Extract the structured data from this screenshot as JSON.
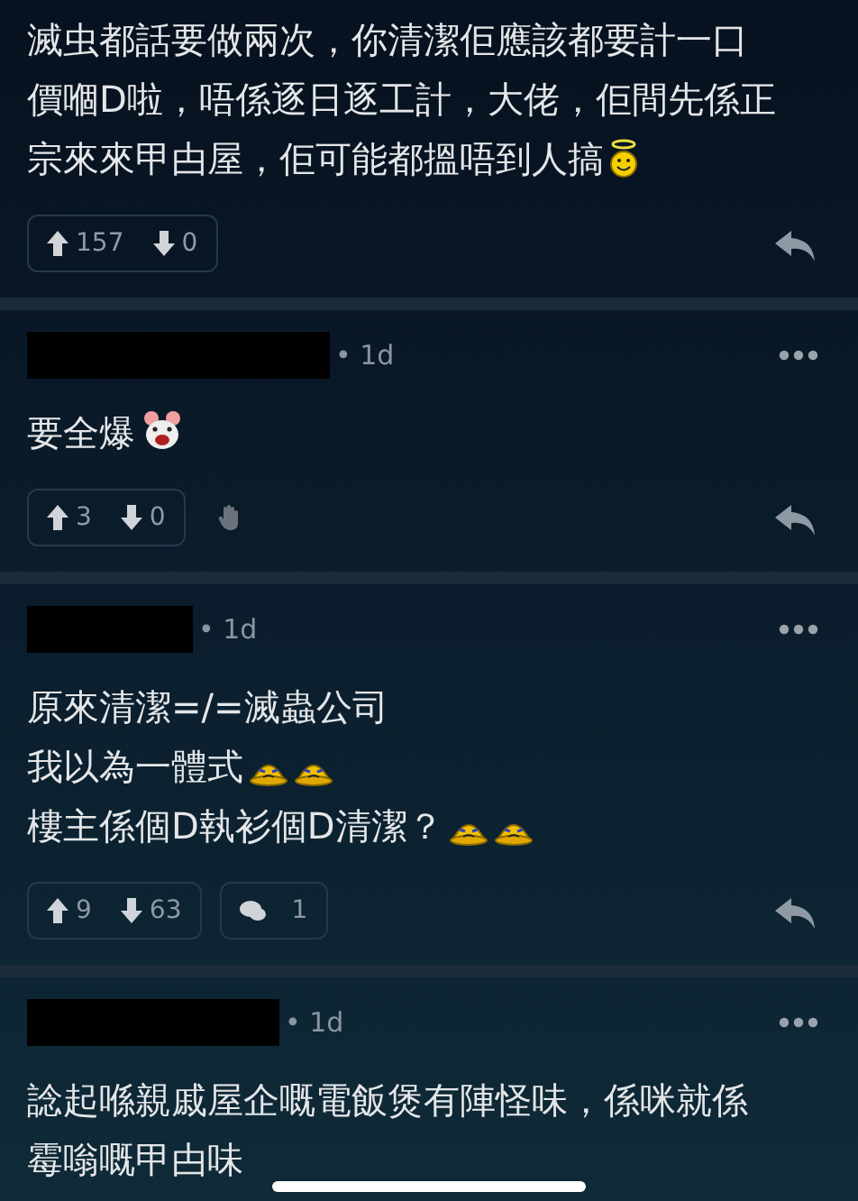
{
  "comments": [
    {
      "body": [
        {
          "text": "滅虫都話要做兩次，你清潔佢應該都要計一口"
        },
        {
          "text": "價嗰D啦，唔係逐日逐工計，大佬，佢間先係正"
        },
        {
          "text": "宗來來甲甴屋，佢可能都搵唔到人搞",
          "emoticons": [
            {
              "kind": "halo"
            }
          ]
        }
      ],
      "upvotes": "157",
      "downvotes": "0"
    },
    {
      "time": "• 1d",
      "body": [
        {
          "text": "要全爆",
          "emoticons": [
            {
              "kind": "mouse"
            }
          ]
        }
      ],
      "upvotes": "3",
      "downvotes": "0",
      "hand_button": true
    },
    {
      "time": "• 1d",
      "body": [
        {
          "text": "原來清潔=/=滅蟲公司"
        },
        {
          "text": "我以為一體式",
          "emoticons": [
            {
              "kind": "crying"
            },
            {
              "kind": "crying"
            }
          ]
        },
        {
          "text": "樓主係個D執衫個D清潔？",
          "emoticons": [
            {
              "kind": "crying"
            },
            {
              "kind": "crying"
            }
          ]
        }
      ],
      "upvotes": "9",
      "downvotes": "63",
      "replies": "1"
    },
    {
      "time": "• 1d",
      "body": [
        {
          "text": "諗起喺親戚屋企嘅電飯煲有陣怪味，係咪就係"
        },
        {
          "text": "霉嗡嘅甲甴味"
        }
      ]
    }
  ]
}
